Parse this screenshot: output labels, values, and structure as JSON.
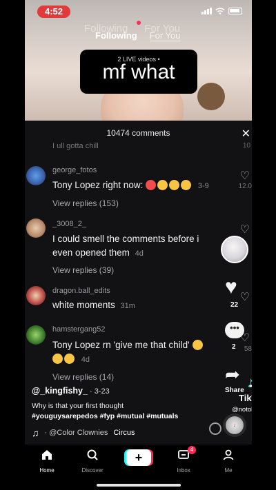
{
  "status_bar": {
    "time": "4:52"
  },
  "feed_tabs": {
    "following": "Following",
    "for_you": "For You"
  },
  "video_caption": {
    "live_text": "2 LIVE videos •",
    "text": "mf what"
  },
  "comments_panel": {
    "title": "10474 comments",
    "cut_text": "I ull gotta chill",
    "cut_time": "10",
    "comments": [
      {
        "user": "george_fotos",
        "text": "Tony Lopez right now:",
        "time": "3-9",
        "replies": "View replies (153)",
        "likes": "12.0"
      },
      {
        "user": "_3008_2_",
        "text": "I could smell the comments before i even opened them",
        "time": "4d",
        "replies": "View replies (39)",
        "likes": ""
      },
      {
        "user": "dragon.ball_edits",
        "text": "white moments",
        "time": "31m",
        "replies": "",
        "likes": ""
      },
      {
        "user": "hamstergang52",
        "text": "Tony Lopez rn 'give me that child'",
        "time": "4d",
        "replies": "View replies (14)",
        "likes": "58"
      }
    ]
  },
  "actions": {
    "like_count": "22",
    "comment_count": "2",
    "share_label": "Share"
  },
  "video_info": {
    "username": "@_kingfishy_",
    "date": "· 3-23",
    "description": "Why is that your first thought",
    "hashtags": "#youguysarepedos #fyp #mutual #mutuals",
    "music_prefix": "· @Color Clownies",
    "music_title": "Circus"
  },
  "watermark": {
    "logo_word": "TikTok",
    "handle": "@notokkyle"
  },
  "bottom_nav": {
    "items": [
      {
        "label": "Home",
        "icon": "home-icon"
      },
      {
        "label": "Discover",
        "icon": "search-icon"
      },
      {
        "label": "",
        "icon": "plus-icon"
      },
      {
        "label": "Inbox",
        "icon": "inbox-icon"
      },
      {
        "label": "Me",
        "icon": "person-icon"
      }
    ],
    "inbox_badge": "4"
  },
  "colors": {
    "accent_red": "#fe2c55",
    "accent_cyan": "#25f4ee",
    "time_pill": "#e03a3a",
    "panel_bg": "#121214"
  }
}
